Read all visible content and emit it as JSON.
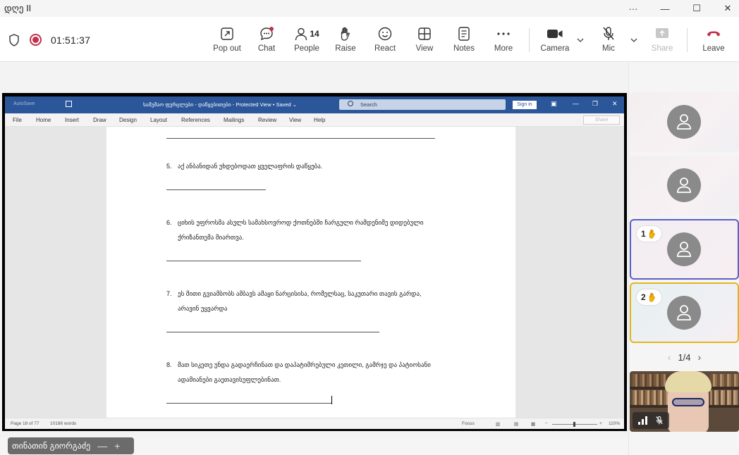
{
  "window": {
    "title": "დღე II",
    "controls": {
      "more": "···",
      "minimize": "—",
      "maximize": "☐",
      "close": "✕"
    }
  },
  "meeting": {
    "timer": "01:51:37",
    "toolbar": [
      {
        "id": "popout",
        "label": "Pop out",
        "icon": "popout-icon"
      },
      {
        "id": "chat",
        "label": "Chat",
        "icon": "chat-icon"
      },
      {
        "id": "people",
        "label": "People",
        "icon": "people-icon",
        "count": "14"
      },
      {
        "id": "raise",
        "label": "Raise",
        "icon": "hand-icon"
      },
      {
        "id": "react",
        "label": "React",
        "icon": "smiley-icon"
      },
      {
        "id": "view",
        "label": "View",
        "icon": "grid-icon"
      },
      {
        "id": "notes",
        "label": "Notes",
        "icon": "notes-icon"
      },
      {
        "id": "more",
        "label": "More",
        "icon": "more-icon"
      },
      {
        "id": "camera",
        "label": "Camera",
        "icon": "camera-icon"
      },
      {
        "id": "mic",
        "label": "Mic",
        "icon": "mic-off-icon"
      },
      {
        "id": "share",
        "label": "Share",
        "icon": "share-icon",
        "disabled": true
      },
      {
        "id": "leave",
        "label": "Leave",
        "icon": "hangup-icon",
        "color": "#c4314b"
      }
    ]
  },
  "word": {
    "doc_title": "სამუშაო ფურცლები - დაწყებითები  -  Protected View  •  Saved ⌄",
    "autosave": "AutoSave",
    "search_placeholder": "Search",
    "sign_in": "Sign in",
    "share_label": "Share",
    "menu": [
      "File",
      "Home",
      "Insert",
      "Draw",
      "Design",
      "Layout",
      "References",
      "Mailings",
      "Review",
      "View",
      "Help"
    ],
    "items": [
      {
        "num": "5.",
        "lines": [
          "აქ ანბანიდან უხდებოდათ ყველაფრის დაწყება."
        ]
      },
      {
        "num": "6.",
        "lines": [
          "ციხის უფროსმა ასულს სამახსოვროდ ქოთნებში ჩარგული რამდენიმე დიდებული",
          "ქრიზანთემა მიართვა."
        ]
      },
      {
        "num": "7.",
        "lines": [
          "ეს მითი გვიამბობს ამბავს ამაყი ნარცისისა, რომელსაც, საკუთარი თავის გარდა,",
          "არავინ უყვარდა"
        ]
      },
      {
        "num": "8.",
        "lines": [
          "მათ სიკეთე უნდა გადაერჩინათ და დაპატიმრებული კეთილი, გამრჯე და პატიოსანი",
          "ადამიანები გაეთავისუფლებინათ."
        ]
      }
    ],
    "status": {
      "page": "Page 18 of 77",
      "words": "10186 words",
      "focus": "Focus",
      "zoom": "110%"
    }
  },
  "gallery": {
    "tiles": [
      {
        "hand_count": ""
      },
      {
        "hand_count": ""
      },
      {
        "hand_count": "1"
      },
      {
        "hand_count": "2"
      }
    ],
    "pager": "1/4",
    "self_name": "თინათინ გიორგაძე",
    "self_controls": {
      "minus": "—",
      "plus": "+"
    }
  },
  "colors": {
    "word_blue": "#2b579a",
    "hand_yellow": "#f5b400",
    "raise_border_1": "#5b5fc7",
    "raise_border_2": "#e4b41c",
    "leave_red": "#c4314b"
  }
}
